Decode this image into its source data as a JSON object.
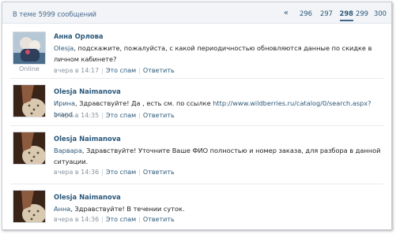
{
  "header": {
    "topic_count": "В теме 5999 сообщений",
    "pager": {
      "prev": "«",
      "pages": [
        "296",
        "297",
        "298",
        "299",
        "300"
      ],
      "current": "298"
    }
  },
  "posts": [
    {
      "author": "Анна Орлова",
      "online": "Online",
      "addressee": "Olesja",
      "text": ", подскажите, пожалуйста, с какой периодичностью обновляются данные по скидке в личном кабинете?",
      "time": "вчера в 14:17",
      "spam": "Это спам",
      "reply": "Ответить"
    },
    {
      "author": "Olesja Naimanova",
      "addressee": "Ирина",
      "text": ", Здравствуйте! Да , есть см. по ссылке ",
      "link": "http://www.wildberries.ru/catalog/0/search.aspx?brand..",
      "time": "вчера в 14:35",
      "spam": "Это спам",
      "reply": "Ответить"
    },
    {
      "author": "Olesja Naimanova",
      "addressee": "Варвара",
      "text": ", Здравствуйте! Уточните Ваше ФИО полностью и номер заказа, для разбора в данной ситуации.",
      "time": "вчера в 14:36",
      "spam": "Это спам",
      "reply": "Ответить"
    },
    {
      "author": "Olesja Naimanova",
      "addressee": "Анна",
      "text": ", Здравствуйте! В течении суток.",
      "time": "вчера в 14:36",
      "spam": "Это спам",
      "reply": "Ответить"
    }
  ],
  "colors": {
    "link": "#2b587a",
    "muted": "#8b94a0",
    "topbar_bg": "#f2f4f7"
  }
}
